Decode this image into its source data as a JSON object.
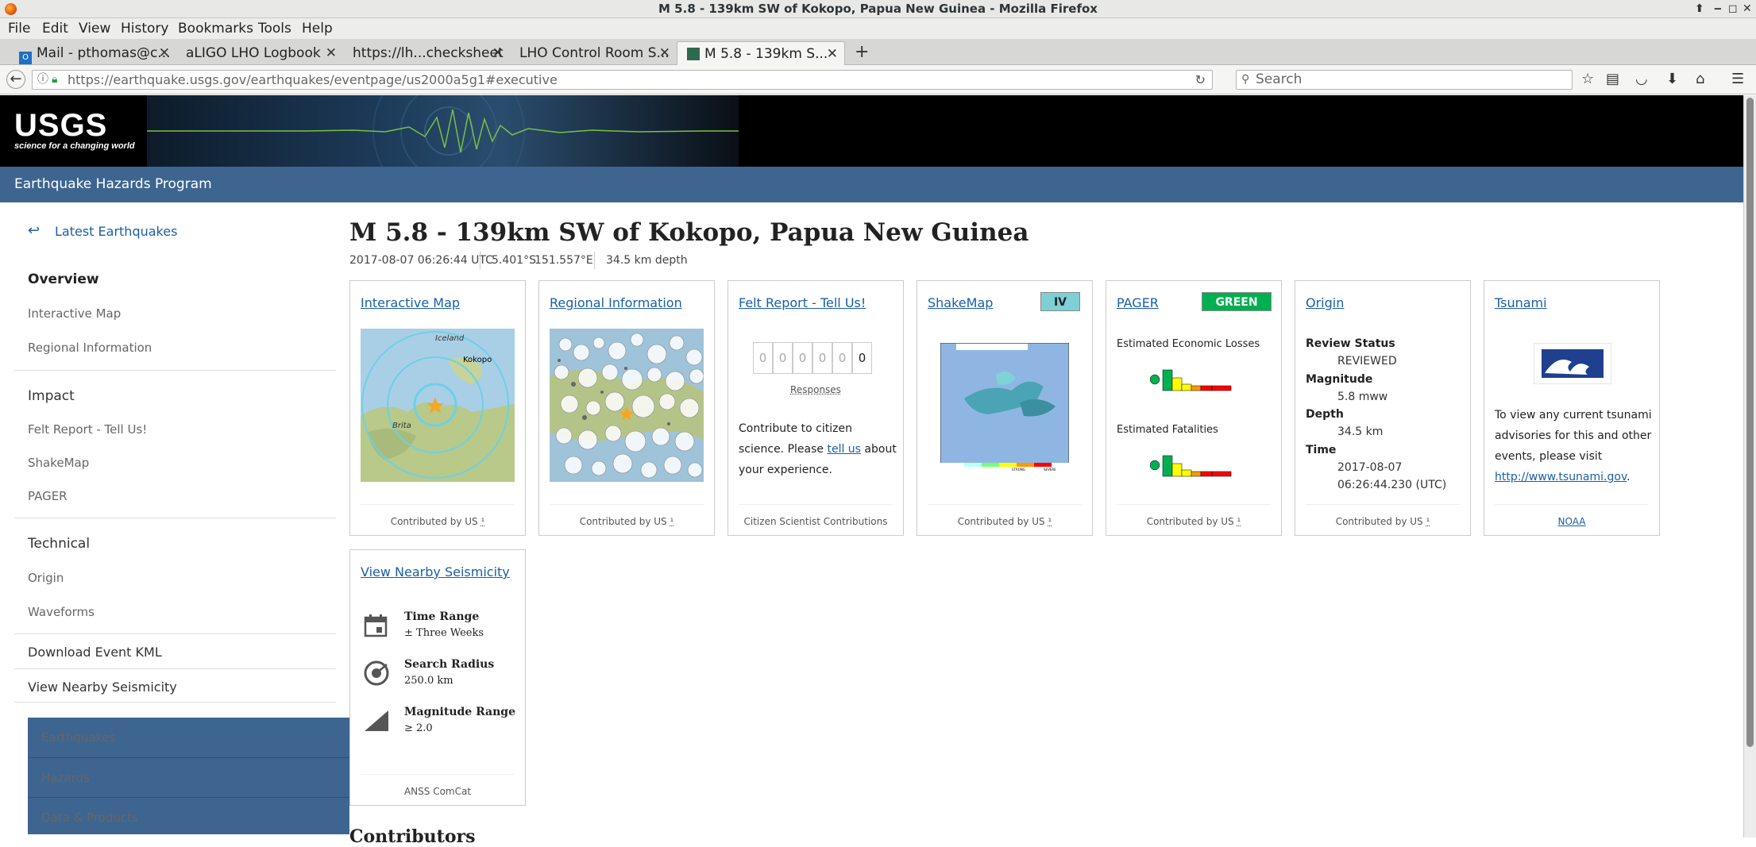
{
  "window": {
    "title": "M 5.8 - 139km SW of Kokopo, Papua New Guinea - Mozilla Firefox"
  },
  "menu": {
    "items": [
      "File",
      "Edit",
      "View",
      "History",
      "Bookmarks",
      "Tools",
      "Help"
    ]
  },
  "tabs": [
    {
      "label": "Mail - pthomas@c...",
      "icon": "outlook-icon"
    },
    {
      "label": "aLIGO LHO Logbook",
      "icon": "none"
    },
    {
      "label": "https://lh...checksheet",
      "icon": "none"
    },
    {
      "label": "LHO Control Room S...",
      "icon": "none"
    },
    {
      "label": "M 5.8 - 139km S...",
      "icon": "usgs-icon",
      "active": true
    }
  ],
  "toolbar": {
    "url": "https://earthquake.usgs.gov/earthquakes/eventpage/us2000a5g1#executive",
    "search_placeholder": "Search"
  },
  "site": {
    "logo_text": "USGS",
    "logo_tagline": "science for a changing world",
    "program": "Earthquake Hazards Program"
  },
  "sidebar": {
    "back_link": "Latest Earthquakes",
    "overview": "Overview",
    "overview_items": [
      "Interactive Map",
      "Regional Information"
    ],
    "impact": "Impact",
    "impact_items": [
      "Felt Report - Tell Us!",
      "ShakeMap",
      "PAGER"
    ],
    "technical": "Technical",
    "technical_items": [
      "Origin",
      "Waveforms"
    ],
    "download_kml": "Download Event KML",
    "nearby": "View Nearby Seismicity",
    "bottom_nav": [
      "Earthquakes",
      "Hazards",
      "Data & Products"
    ]
  },
  "event": {
    "title": "M 5.8 - 139km SW of Kokopo, Papua New Guinea",
    "time": "2017-08-07 06:26:44 UTC",
    "lat": "5.401°S",
    "lon": "151.557°E",
    "depth": "34.5 km depth"
  },
  "cards": {
    "interactive_map": {
      "title": "Interactive Map",
      "footer": "Contributed by US",
      "map_labels": [
        "Kokopo",
        "Iceland",
        "Brita"
      ]
    },
    "regional": {
      "title": "Regional Information",
      "footer": "Contributed by US"
    },
    "felt": {
      "title": "Felt Report - Tell Us!",
      "digits": [
        "0",
        "0",
        "0",
        "0",
        "0",
        "0"
      ],
      "responses": "Responses",
      "text_before": "Contribute to citizen science. Please ",
      "link": "tell us",
      "text_after": " about your experience.",
      "footer": "Citizen Scientist Contributions"
    },
    "shakemap": {
      "title": "ShakeMap",
      "intensity": "IV",
      "intensity_color": "#7ecfd6",
      "footer": "Contributed by US",
      "scale": [
        "SEVERE",
        "STRONG",
        "WEAK",
        "LIGHT"
      ]
    },
    "pager": {
      "title": "PAGER",
      "alert": "GREEN",
      "alert_color": "#00b050",
      "losses": "Estimated Economic Losses",
      "fatalities": "Estimated Fatalities",
      "footer": "Contributed by US"
    },
    "origin": {
      "title": "Origin",
      "review_status_label": "Review Status",
      "review_status": "REVIEWED",
      "magnitude_label": "Magnitude",
      "magnitude": "5.8 mww",
      "depth_label": "Depth",
      "depth": "34.5 km",
      "time_label": "Time",
      "time_date": "2017-08-07",
      "time_clock": "06:26:44.230 (UTC)",
      "footer": "Contributed by US"
    },
    "tsunami": {
      "title": "Tsunami",
      "text": "To view any current tsunami advisories for this and other events, please visit",
      "link": "http://www.tsunami.gov",
      "footer": "NOAA"
    },
    "nearby": {
      "title": "View Nearby Seismicity",
      "time_range_label": "Time Range",
      "time_range": "± Three Weeks",
      "radius_label": "Search Radius",
      "radius": "250.0 km",
      "mag_label": "Magnitude Range",
      "mag": "≥ 2.0",
      "footer": "ANSS ComCat"
    }
  },
  "contributors_heading": "Contributors"
}
